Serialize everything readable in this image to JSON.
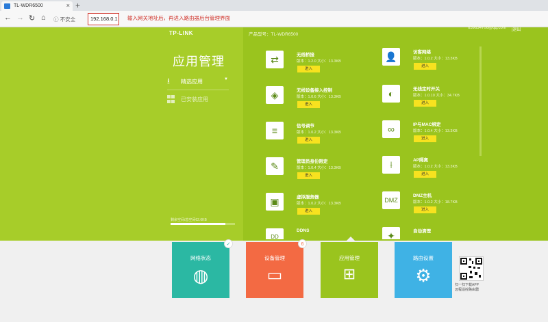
{
  "browser": {
    "tab_title": "TL-WDR6500",
    "tab_close": "×",
    "new_tab": "+",
    "security_label": "ⓘ 不安全",
    "address": "192.168.0.1",
    "annotation": "输入网关地址后，再进入路由器后台管理界面"
  },
  "header": {
    "brand": "TP-LINK",
    "product_model": "产品型号：TL-WDR6500",
    "account": "659634706@qq.com",
    "logout": "|退出"
  },
  "sidebar": {
    "title": "应用管理",
    "items": [
      {
        "label": "精选应用",
        "icon": "download-icon",
        "selected": true
      },
      {
        "label": "已安装应用",
        "icon": "grid-icon",
        "selected": false
      }
    ],
    "storage_text": "剩余空间/总空间62.6KB",
    "storage_fraction": 0.85
  },
  "apps": [
    {
      "name": "无线桥接",
      "version": "版本：1.2.0 大小：13.3KB",
      "button": "进入",
      "icon": "bridge-icon"
    },
    {
      "name": "访客网络",
      "version": "版本：1.0.2 大小：13.3KB",
      "button": "进入",
      "icon": "guest-icon"
    },
    {
      "name": "无线设备接入控制",
      "version": "版本：1.0.6 大小：13.3KB",
      "button": "进入",
      "icon": "wifi-shield-icon"
    },
    {
      "name": "无线定时开关",
      "version": "版本：1.0.10 大小：34.7KB",
      "button": "进入",
      "icon": "toggle-icon"
    },
    {
      "name": "信号调节",
      "version": "版本：1.0.2 大小：13.3KB",
      "button": "进入",
      "icon": "equalizer-icon"
    },
    {
      "name": "IP与MAC绑定",
      "version": "版本：1.0.4 大小：13.3KB",
      "button": "进入",
      "icon": "link-icon"
    },
    {
      "name": "管理员身份限定",
      "version": "版本：1.0.4 大小：13.3KB",
      "button": "进入",
      "icon": "wrench-icon"
    },
    {
      "name": "AP隔离",
      "version": "版本：1.0.2 大小：13.3KB",
      "button": "进入",
      "icon": "isolation-icon"
    },
    {
      "name": "虚拟服务器",
      "version": "版本：1.0.2 大小：13.3KB",
      "button": "进入",
      "icon": "server-icon"
    },
    {
      "name": "DMZ主机",
      "version": "版本：1.0.2 大小：18.7KB",
      "button": "进入",
      "icon": "dmz-icon"
    },
    {
      "name": "DDNS",
      "version": "",
      "button": "",
      "icon": "ddns-icon"
    },
    {
      "name": "自动清理",
      "version": "",
      "button": "",
      "icon": "clean-icon"
    }
  ],
  "bottom_nav": [
    {
      "label": "网络状态",
      "color": "#2bb8a3",
      "icon": "globe-icon",
      "badge": "✓"
    },
    {
      "label": "设备管理",
      "color": "#f36a43",
      "icon": "laptop-icon",
      "badge": "6"
    },
    {
      "label": "应用管理",
      "color": "#9ac41e",
      "icon": "apps-grid-icon",
      "badge": ""
    },
    {
      "label": "路由设置",
      "color": "#3fb2e5",
      "icon": "gear-icon",
      "badge": ""
    }
  ],
  "qr": {
    "caption_line1": "扫一扫下载APP",
    "caption_line2": "远程遥控路由器"
  },
  "colors": {
    "green": "#9ac41e",
    "yellow_button": "#f7e21f",
    "annotation_red": "#d0342c"
  }
}
